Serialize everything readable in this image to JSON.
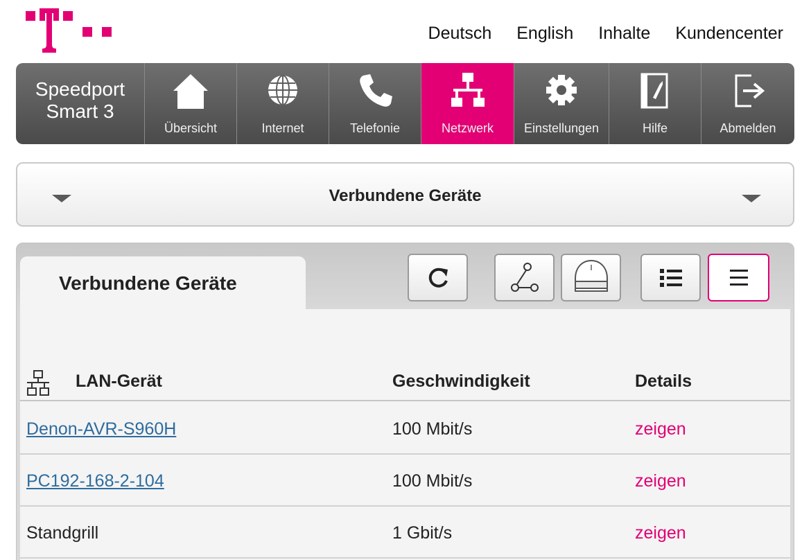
{
  "brand": {
    "color": "#e20074"
  },
  "top_links": [
    "Deutsch",
    "English",
    "Inhalte",
    "Kundencenter"
  ],
  "nav": {
    "brand_line1": "Speedport",
    "brand_line2": "Smart 3",
    "items": [
      {
        "label": "Übersicht",
        "icon": "home-icon"
      },
      {
        "label": "Internet",
        "icon": "globe-icon"
      },
      {
        "label": "Telefonie",
        "icon": "phone-icon"
      },
      {
        "label": "Netzwerk",
        "icon": "network-icon",
        "active": true
      },
      {
        "label": "Einstellungen",
        "icon": "gear-icon"
      },
      {
        "label": "Hilfe",
        "icon": "help-book-icon"
      },
      {
        "label": "Abmelden",
        "icon": "logout-icon"
      }
    ]
  },
  "section": {
    "title": "Verbundene Geräte"
  },
  "panel": {
    "tab_label": "Verbundene Geräte",
    "toolbar": [
      "refresh-icon",
      "topology-icon",
      "router-icon",
      "list-icon",
      "menu-icon"
    ],
    "selected_view": "menu-icon"
  },
  "table": {
    "headers": {
      "device": "LAN-Gerät",
      "speed": "Geschwindigkeit",
      "details": "Details"
    },
    "rows": [
      {
        "name": "Denon-AVR-S960H",
        "speed": "100 Mbit/s",
        "details": "zeigen",
        "linked": true
      },
      {
        "name": "PC192-168-2-104",
        "speed": "100 Mbit/s",
        "details": "zeigen",
        "linked": true
      },
      {
        "name": "Standgrill",
        "speed": "1 Gbit/s",
        "details": "zeigen",
        "linked": false
      }
    ]
  }
}
